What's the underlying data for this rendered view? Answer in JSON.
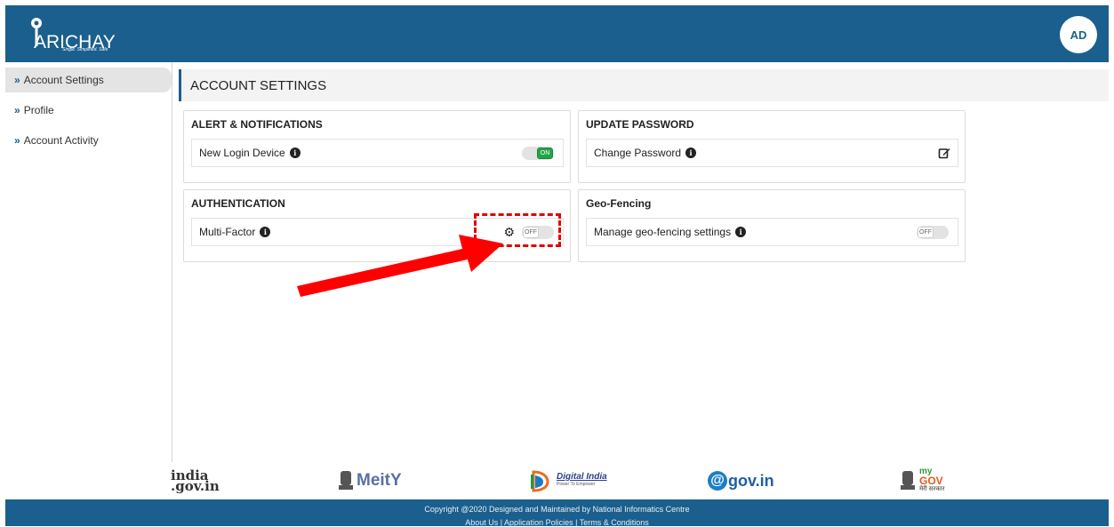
{
  "header": {
    "logo_text": "ARICHAY",
    "logo_tagline": "Single. Simplified. Safe",
    "avatar_initials": "AD"
  },
  "sidebar": {
    "items": [
      {
        "label": "Account Settings",
        "active": true
      },
      {
        "label": "Profile",
        "active": false
      },
      {
        "label": "Account Activity",
        "active": false
      }
    ]
  },
  "main": {
    "page_title": "ACCOUNT SETTINGS",
    "cards": {
      "alerts": {
        "title": "ALERT & NOTIFICATIONS",
        "row_label": "New Login Device",
        "toggle": "ON"
      },
      "password": {
        "title": "UPDATE PASSWORD",
        "row_label": "Change Password"
      },
      "auth": {
        "title": "AUTHENTICATION",
        "row_label": "Multi-Factor",
        "toggle": "OFF"
      },
      "geo": {
        "title": "Geo-Fencing",
        "row_label": "Manage geo-fencing settings",
        "toggle": "OFF"
      }
    }
  },
  "partners": {
    "india_gov_line1": "india",
    "india_gov_line2": ".gov.in",
    "meity": "MeitY",
    "digital_india": "Digital India",
    "digital_india_tag": "Power To Empower",
    "gov_in": "gov.in",
    "mygov_my": "my",
    "mygov_gov": "GOV",
    "mygov_hindi": "मेरी सरकार"
  },
  "footer": {
    "copyright": "Copyright @2020 Designed and Maintained by National Informatics Centre",
    "links": "About Us | Application Policies | Terms & Conditions"
  },
  "colors": {
    "brand": "#1a5f8e",
    "toggle_on": "#22a447",
    "highlight": "#e00000"
  },
  "icons": [
    "info-icon",
    "gear-icon",
    "edit-icon",
    "chevron-right-icon"
  ]
}
